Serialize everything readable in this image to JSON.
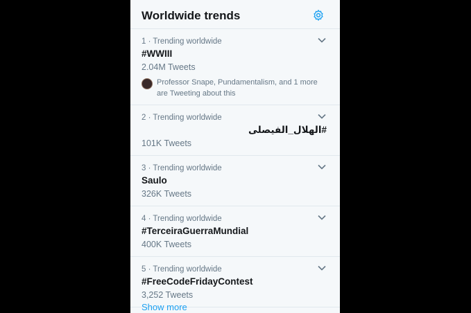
{
  "header": {
    "title": "Worldwide trends",
    "settings_icon": "gear-icon",
    "accent": "#1da1f2"
  },
  "trends": [
    {
      "meta": "1 · Trending worldwide",
      "name": "#WWIII",
      "count": "2.04M Tweets",
      "context": "Professor Snape, Pundamentalism, and 1 more are Tweeting about this"
    },
    {
      "meta": "2 · Trending worldwide",
      "name": "#الهلال_الفيصلى",
      "count": "101K Tweets"
    },
    {
      "meta": "3 · Trending worldwide",
      "name": "Saulo",
      "count": "326K Tweets"
    },
    {
      "meta": "4 · Trending worldwide",
      "name": "#TerceiraGuerraMundial",
      "count": "400K Tweets"
    },
    {
      "meta": "5 · Trending worldwide",
      "name": "#FreeCodeFridayContest",
      "count": "3,252 Tweets"
    }
  ],
  "footer": {
    "show_more": "Show more"
  }
}
